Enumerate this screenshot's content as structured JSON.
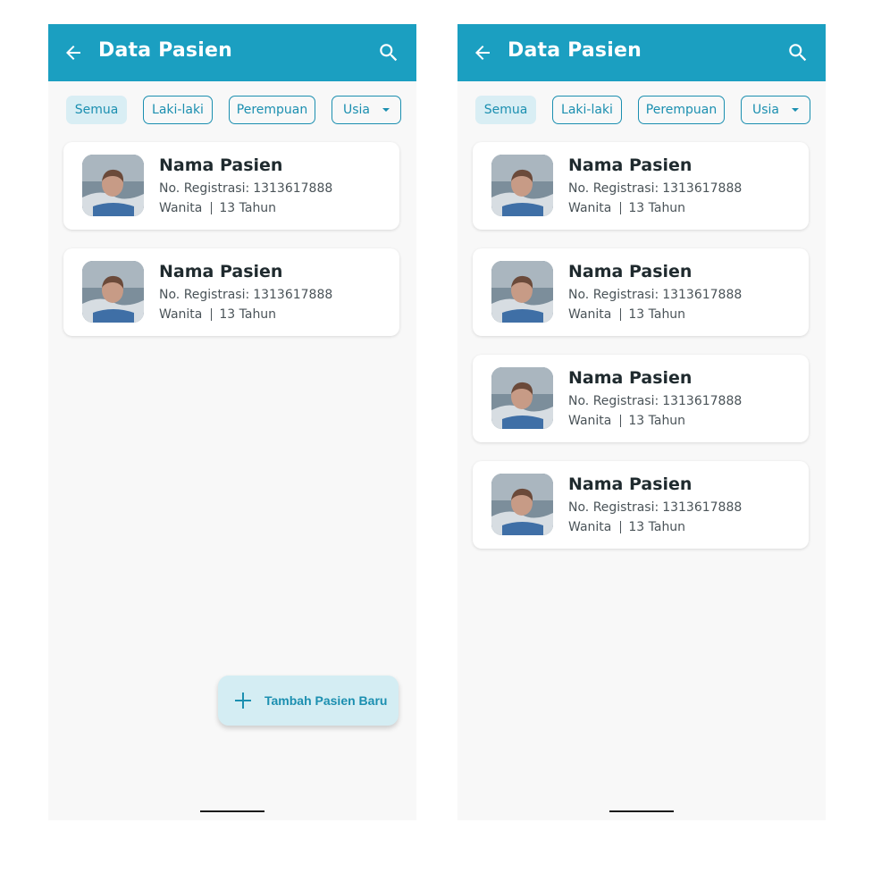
{
  "colors": {
    "appbar": "#1b9fc1",
    "accent": "#1b8fb0",
    "chip_active_bg": "#d9eef4",
    "fab_bg": "#d4edf3",
    "background": "#f8f8f8"
  },
  "screens": [
    {
      "appbar": {
        "title": "Data Pasien",
        "back_icon": "arrow-back-icon",
        "search_icon": "search-icon"
      },
      "filters": {
        "all": "Semua",
        "male": "Laki-laki",
        "female": "Perempuan",
        "age": "Usia",
        "active": "Semua"
      },
      "patients": [
        {
          "name": "Nama Pasien",
          "reg_label": "No. Registrasi:",
          "reg_no": "1313617888",
          "gender": "Wanita",
          "age": "13 Tahun"
        },
        {
          "name": "Nama Pasien",
          "reg_label": "No. Registrasi:",
          "reg_no": "1313617888",
          "gender": "Wanita",
          "age": "13 Tahun"
        }
      ],
      "fab": {
        "label": "Tambah Pasien Baru",
        "icon": "plus-icon"
      }
    },
    {
      "appbar": {
        "title": "Data Pasien",
        "back_icon": "arrow-back-icon",
        "search_icon": "search-icon"
      },
      "filters": {
        "all": "Semua",
        "male": "Laki-laki",
        "female": "Perempuan",
        "age": "Usia",
        "active": "Semua"
      },
      "patients": [
        {
          "name": "Nama Pasien",
          "reg_label": "No. Registrasi:",
          "reg_no": "1313617888",
          "gender": "Wanita",
          "age": "13 Tahun"
        },
        {
          "name": "Nama Pasien",
          "reg_label": "No. Registrasi:",
          "reg_no": "1313617888",
          "gender": "Wanita",
          "age": "13 Tahun"
        },
        {
          "name": "Nama Pasien",
          "reg_label": "No. Registrasi:",
          "reg_no": "1313617888",
          "gender": "Wanita",
          "age": "13 Tahun"
        },
        {
          "name": "Nama Pasien",
          "reg_label": "No. Registrasi:",
          "reg_no": "1313617888",
          "gender": "Wanita",
          "age": "13 Tahun"
        }
      ]
    }
  ]
}
